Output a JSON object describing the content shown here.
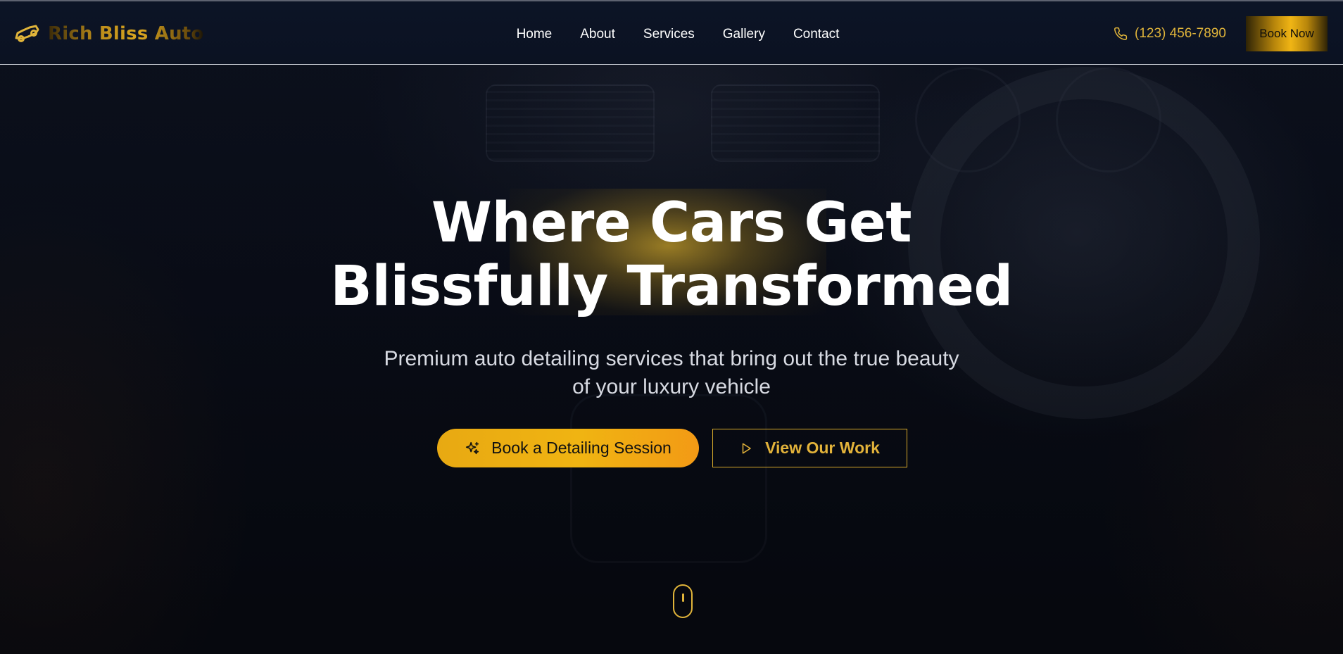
{
  "brand": {
    "name": "Rich Bliss Auto",
    "logo_icon": "car-icon",
    "accent_color": "#e0b43a"
  },
  "nav": {
    "items": [
      {
        "label": "Home"
      },
      {
        "label": "About"
      },
      {
        "label": "Services"
      },
      {
        "label": "Gallery"
      },
      {
        "label": "Contact"
      }
    ],
    "phone_icon": "phone-icon",
    "phone": "(123) 456-7890",
    "cta": "Book Now"
  },
  "hero": {
    "title_line1": "Where Cars Get",
    "title_line2": "Blissfully Transformed",
    "subtitle_line1": "Premium auto detailing services that bring out the true beauty",
    "subtitle_line2": "of your luxury vehicle",
    "primary_button": {
      "label": "Book a Detailing Session",
      "icon": "sparkles-icon"
    },
    "secondary_button": {
      "label": "View Our Work",
      "icon": "play-icon"
    },
    "scroll_indicator_icon": "mouse-scroll-icon"
  }
}
